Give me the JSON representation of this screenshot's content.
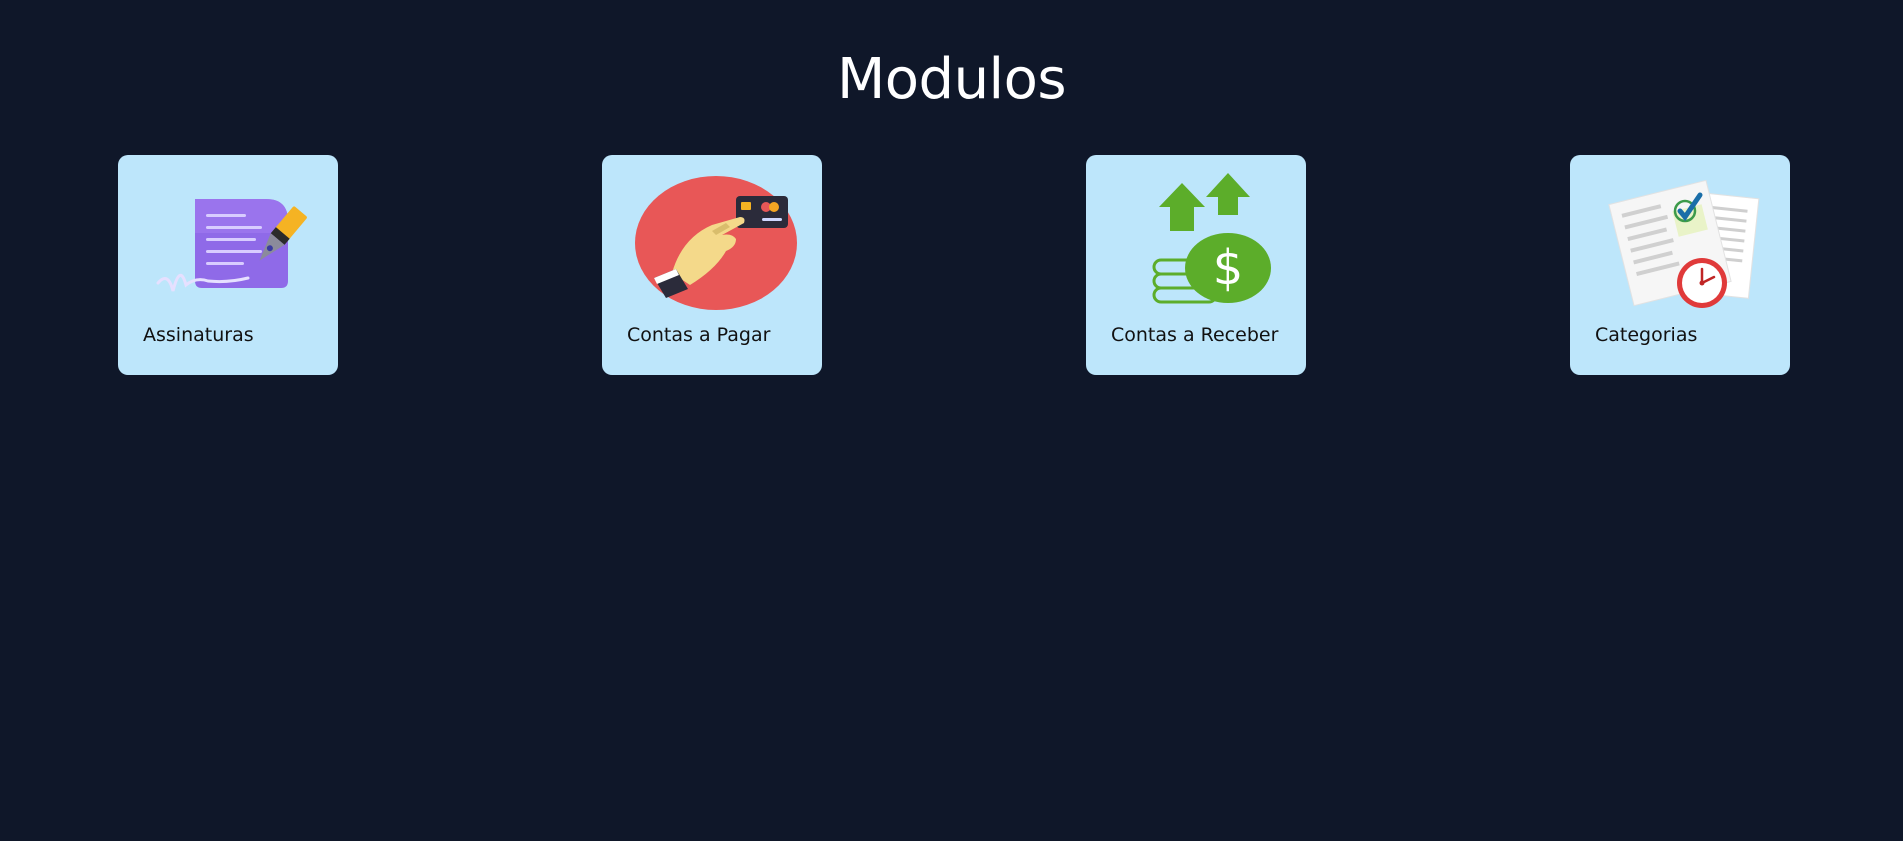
{
  "page": {
    "title": "Modulos",
    "background_color": "#0f1729",
    "card_color": "#bde6fb"
  },
  "modules": [
    {
      "label": "Assinaturas",
      "icon": "signature-pen-icon"
    },
    {
      "label": "Contas a Pagar",
      "icon": "card-payment-icon"
    },
    {
      "label": "Contas a Receber",
      "icon": "money-growth-icon"
    },
    {
      "label": "Categorias",
      "icon": "documents-clock-icon"
    }
  ]
}
